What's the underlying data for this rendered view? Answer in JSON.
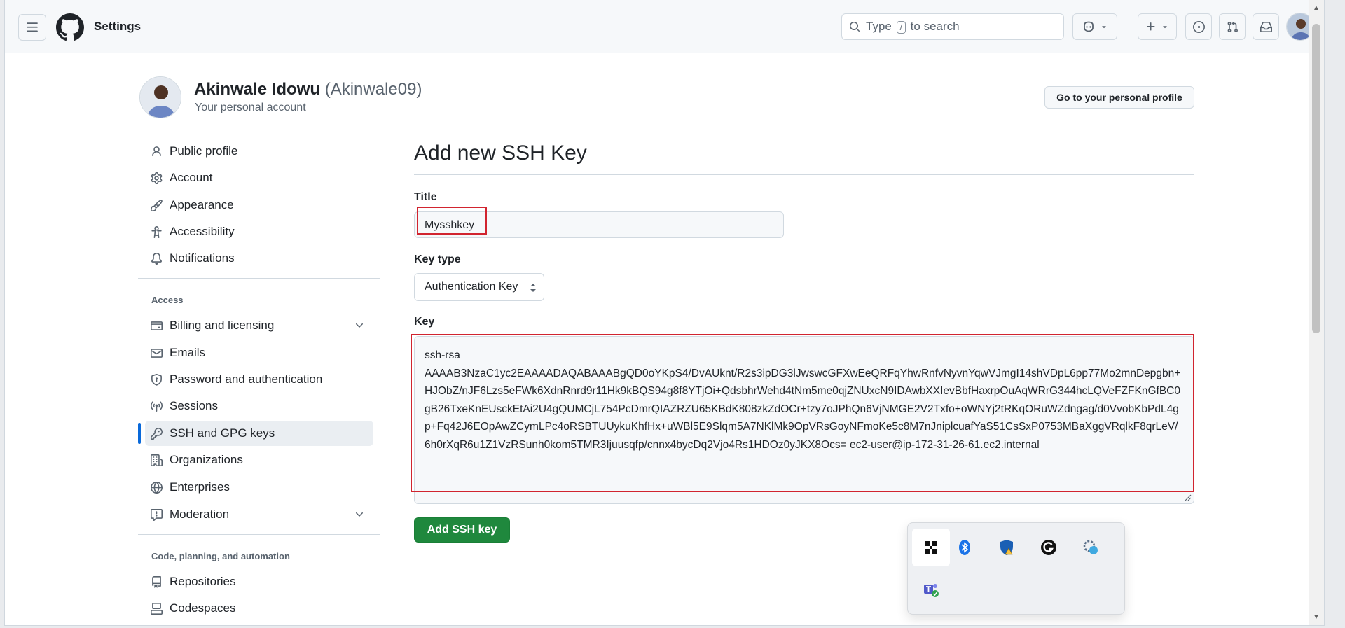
{
  "header": {
    "context_title": "Settings",
    "search_prefix": "Type",
    "search_key": "/",
    "search_suffix": "to search"
  },
  "account": {
    "name": "Akinwale Idowu",
    "handle": "(Akinwale09)",
    "subtitle": "Your personal account",
    "profile_button": "Go to your personal profile"
  },
  "sidebar": {
    "items_top": [
      {
        "label": "Public profile",
        "icon": "person-icon"
      },
      {
        "label": "Account",
        "icon": "gear-icon"
      },
      {
        "label": "Appearance",
        "icon": "paintbrush-icon"
      },
      {
        "label": "Accessibility",
        "icon": "accessibility-icon"
      },
      {
        "label": "Notifications",
        "icon": "bell-icon"
      }
    ],
    "access_heading": "Access",
    "items_access": [
      {
        "label": "Billing and licensing",
        "icon": "credit-card-icon"
      },
      {
        "label": "Emails",
        "icon": "mail-icon"
      },
      {
        "label": "Password and authentication",
        "icon": "shield-lock-icon"
      },
      {
        "label": "Sessions",
        "icon": "broadcast-icon"
      },
      {
        "label": "SSH and GPG keys",
        "icon": "key-icon",
        "active": true
      },
      {
        "label": "Organizations",
        "icon": "organization-icon"
      },
      {
        "label": "Enterprises",
        "icon": "globe-icon"
      },
      {
        "label": "Moderation",
        "icon": "report-icon"
      }
    ],
    "code_heading": "Code, planning, and automation",
    "items_code": [
      {
        "label": "Repositories",
        "icon": "repo-icon"
      },
      {
        "label": "Codespaces",
        "icon": "codespaces-icon"
      }
    ]
  },
  "form": {
    "heading": "Add new SSH Key",
    "title_label": "Title",
    "title_value": "Mysshkey",
    "key_type_label": "Key type",
    "key_type_value": "Authentication Key",
    "key_label": "Key",
    "key_value": "ssh-rsa\nAAAAB3NzaC1yc2EAAAADAQABAAABgQD0oYKpS4/DvAUknt/R2s3ipDG3lJwswcGFXwEeQRFqYhwRnfvNyvnYqwVJmgI14shVDpL6pp77Mo2mnDepgbn+HJObZ/nJF6Lzs5eFWk6XdnRnrd9r11Hk9kBQS94g8f8YTjOi+QdsbhrWehd4tNm5me0qjZNUxcN9IDAwbXXIevBbfHaxrpOuAqWRrG344hcLQVeFZFKnGfBC0gB26TxeKnEUsckEtAi2U4gQUMCjL754PcDmrQIAZRZU65KBdK808zkZdOCr+tzy7oJPhQn6VjNMGE2V2Txfo+oWNYj2tRKqORuWZdngag/d0VvobKbPdL4gp+Fq42J6EOpAwZCymLPc4oRSBTUUykuKhfHx+uWBl5E9Slqm5A7NKlMk9OpVRsGoyNFmoKe5c8M7nJniplcuafYaS51CsSxP0753MBaXggVRqlkF8qrLeV/6h0rXqR6u1Z1VzRSunh0kom5TMR3Ijuusqfp/cnnx4bycDq2Vjo4Rs1HDOz0yJKX8Ocs= ec2-user@ip-172-31-26-61.ec2.internal",
    "submit_label": "Add SSH key"
  },
  "tray": {
    "icons": [
      "app-grid-icon",
      "bluetooth-icon",
      "security-warning-icon",
      "grammarly-icon",
      "settings-sync-icon",
      "teams-icon"
    ]
  },
  "colors": {
    "primary_button": "#1f883d",
    "active_indicator": "#0969da",
    "highlight_box": "#d1242f"
  }
}
